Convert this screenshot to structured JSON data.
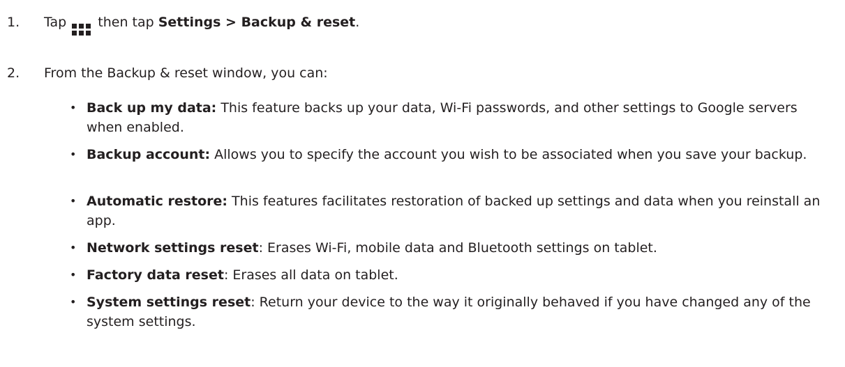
{
  "steps": [
    {
      "number": "1.",
      "prefix": "Tap",
      "icon": "apps-grid-icon",
      "middle": "then tap",
      "bold": "Settings > Backup & reset",
      "suffix": "."
    },
    {
      "number": "2.",
      "text": "From the Backup & reset window, you can:"
    }
  ],
  "bullets": [
    {
      "term": "Back up my data:",
      "desc": " This feature backs up your data, Wi-Fi passwords, and other settings to Google servers when enabled."
    },
    {
      "term": "Backup account:",
      "desc": " Allows you to specify the account you wish to be associated when you save your backup."
    },
    {
      "term": "Automatic restore:",
      "desc": " This features facilitates restoration of backed up settings and data when you reinstall an app."
    },
    {
      "term": "Network settings reset",
      "desc": ": Erases Wi-Fi, mobile data and Bluetooth settings on tablet."
    },
    {
      "term": "Factory data reset",
      "desc": ": Erases all data on tablet."
    },
    {
      "term": "System settings reset",
      "desc": ": Return your device to the way it originally behaved if you have changed any of the system settings."
    }
  ],
  "bullet_symbol": "•"
}
